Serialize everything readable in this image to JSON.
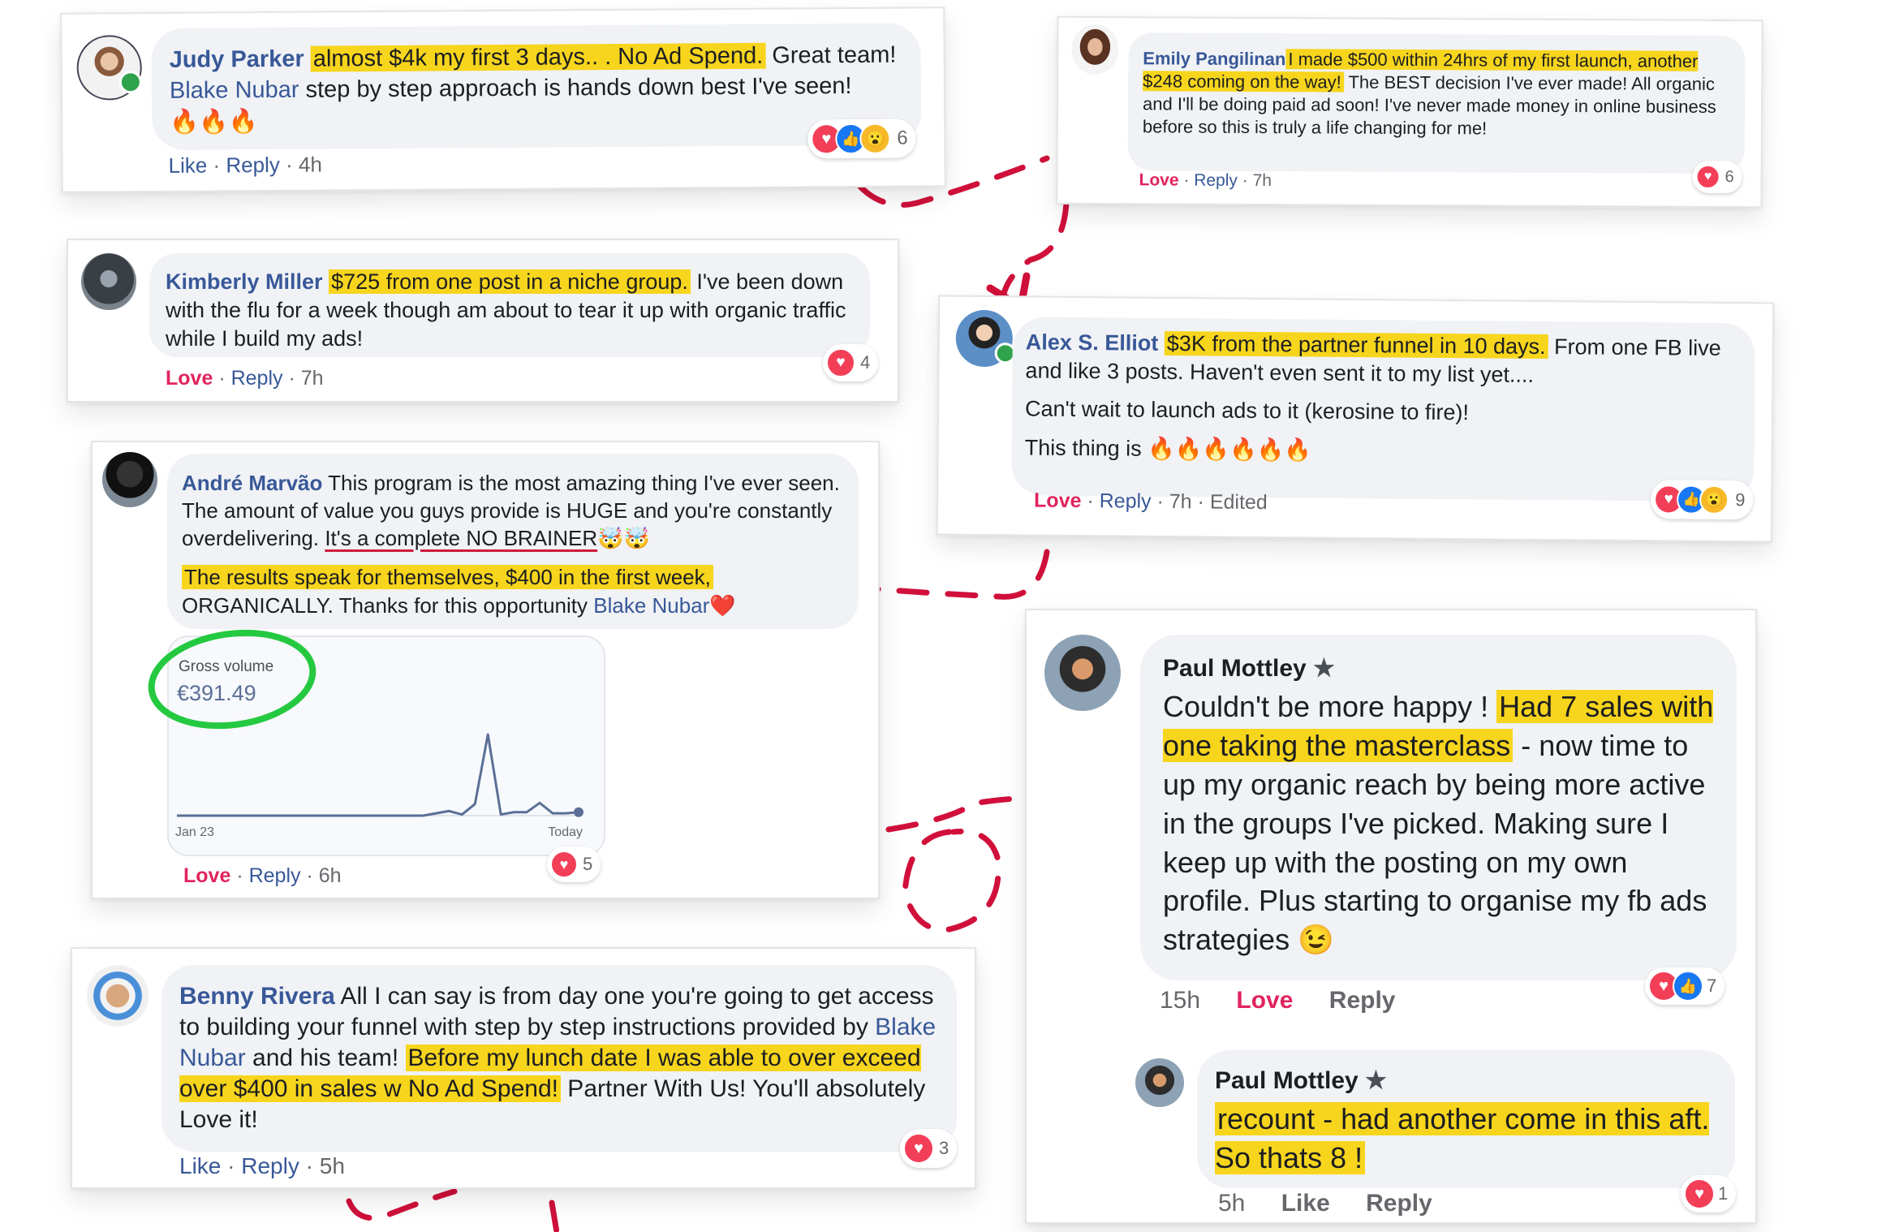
{
  "colors": {
    "link": "#385898",
    "highlight": "#f7d51d",
    "love": "#e0245e",
    "connector": "#d0103a",
    "circle": "#25c940",
    "chart_line": "#5b6f96"
  },
  "comments": {
    "judy": {
      "name": "Judy Parker",
      "highlight": "almost $4k my first 3 days.. . No Ad Spend.",
      "text_a": " Great team! ",
      "mention": "Blake Nubar",
      "text_b": " step by step approach is hands down best I've seen! ",
      "emoji": "🔥🔥🔥",
      "action_1": "Like",
      "action_2": "Reply",
      "time": "4h",
      "reactions": [
        "love-icon",
        "like-icon",
        "wow-icon"
      ],
      "reaction_count": "6",
      "online": true
    },
    "emily": {
      "name": "Emily Pangilinan",
      "highlight": "I made $500 within 24hrs of my first launch, another $248 coming on the way!",
      "text": " The BEST decision I've ever made! All organic and I'll be doing paid ad soon! I've never made money in online business before so this is truly a life changing for me!",
      "action_1": "Love",
      "action_2": "Reply",
      "time": "7h",
      "reactions": [
        "love-icon"
      ],
      "reaction_count": "6"
    },
    "kimberly": {
      "name": "Kimberly Miller",
      "highlight": "$725 from one post in a niche group.",
      "text": " I've been down with the flu for a week though am about to tear it up with organic traffic while I build my ads!",
      "action_1": "Love",
      "action_2": "Reply",
      "time": "7h",
      "reactions": [
        "love-icon"
      ],
      "reaction_count": "4"
    },
    "alex": {
      "name": "Alex S. Elliot",
      "highlight": "$3K from the partner funnel in 10 days.",
      "text_1": " From one FB live and like 3 posts. Haven't even sent it to my list yet....",
      "text_2": "Can't wait to launch ads to it (kerosine to fire)!",
      "text_3": "This thing is ",
      "emoji": "🔥🔥🔥🔥🔥🔥",
      "action_1": "Love",
      "action_2": "Reply",
      "time": "7h",
      "edited": "Edited",
      "reactions": [
        "love-icon",
        "like-icon",
        "wow-icon"
      ],
      "reaction_count": "9",
      "online": true
    },
    "andre": {
      "name": "André Marvão",
      "text_1": " This program is the most amazing thing I've ever seen. The amount of value you guys provide is HUGE and you're constantly overdelivering. ",
      "underlined": "It's a complete NO BRAINER",
      "emoji_1": " 🤯🤯",
      "highlight": "The results speak for themselves, $400 in the first week,",
      "text_2": "ORGANICALLY. Thanks for this opportunity ",
      "mention": "Blake Nubar",
      "emoji_2": " ❤️",
      "chart": {
        "label": "Gross volume",
        "value": "€391.49",
        "x_start": "Jan 23",
        "x_end": "Today"
      },
      "action_1": "Love",
      "action_2": "Reply",
      "time": "6h",
      "reactions": [
        "love-icon"
      ],
      "reaction_count": "5"
    },
    "paul": {
      "name": "Paul Mottley",
      "badge": "★",
      "text_1": "Couldn't be more happy ! ",
      "highlight": "Had 7 sales with one taking the masterclass",
      "text_2": " - now time to up my organic reach by being more active in the groups I've picked. Making sure I keep up with the posting on my own profile. Plus starting to organise my fb ads strategies ",
      "emoji": "😉",
      "time": "15h",
      "action_1": "Love",
      "action_2": "Reply",
      "reactions": [
        "love-icon",
        "like-icon"
      ],
      "reaction_count": "7",
      "reply": {
        "name": "Paul Mottley",
        "badge": "★",
        "highlight": "recount - had another come in this aft. So thats 8 !",
        "time": "5h",
        "action_1": "Like",
        "action_2": "Reply",
        "reactions": [
          "love-icon"
        ],
        "reaction_count": "1"
      }
    },
    "benny": {
      "name": "Benny Rivera",
      "text_1": " All I can say is from day one you're going to get access to building your funnel with step by step instructions provided by ",
      "mention": "Blake Nubar",
      "text_2": " and his team! ",
      "highlight": "Before my lunch date I was able to over exceed over $400 in sales w No Ad Spend!",
      "text_3": " Partner With Us! You'll absolutely Love it!",
      "action_1": "Like",
      "action_2": "Reply",
      "time": "5h",
      "reactions": [
        "love-icon"
      ],
      "reaction_count": "3"
    }
  },
  "chart_data": {
    "type": "line",
    "title": "Gross volume",
    "total": "€391.49",
    "x_labels": [
      "Jan 23",
      "Today"
    ],
    "series": [
      {
        "name": "Gross volume",
        "values": [
          0,
          0,
          0,
          0,
          0,
          0,
          0,
          0,
          0,
          0,
          0,
          0,
          0,
          0,
          0,
          0,
          0,
          0,
          0,
          0,
          2,
          4,
          1,
          10,
          70,
          1,
          3,
          3,
          11,
          2,
          2,
          3
        ]
      }
    ]
  }
}
